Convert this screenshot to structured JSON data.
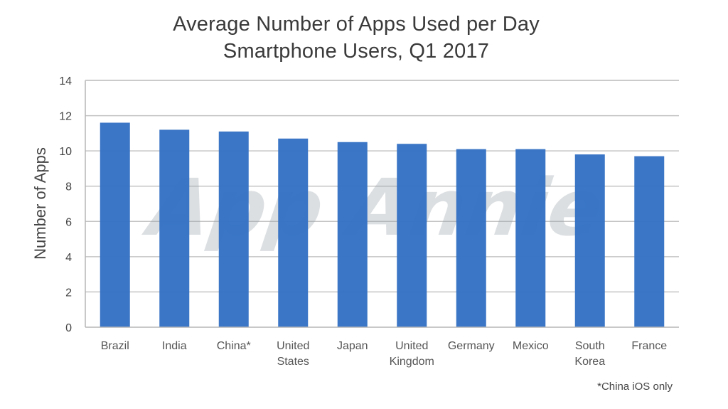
{
  "chart_data": {
    "type": "bar",
    "title": "Average Number of Apps Used per Day",
    "subtitle": "Smartphone Users, Q1 2017",
    "xlabel": "",
    "ylabel": "Number of Apps",
    "ylim": [
      0,
      14
    ],
    "yticks": [
      0,
      2,
      4,
      6,
      8,
      10,
      12,
      14
    ],
    "grid": true,
    "categories": [
      [
        "Brazil"
      ],
      [
        "India"
      ],
      [
        "China*"
      ],
      [
        "United",
        "States"
      ],
      [
        "Japan"
      ],
      [
        "United",
        "Kingdom"
      ],
      [
        "Germany"
      ],
      [
        "Mexico"
      ],
      [
        "South",
        "Korea"
      ],
      [
        "France"
      ]
    ],
    "values": [
      11.6,
      11.2,
      11.1,
      10.7,
      10.5,
      10.4,
      10.1,
      10.1,
      9.8,
      9.7
    ],
    "bar_color": "#3572c4",
    "grid_color": "#c4c4c4",
    "watermark": "App Annie",
    "footnote": "*China iOS only"
  }
}
